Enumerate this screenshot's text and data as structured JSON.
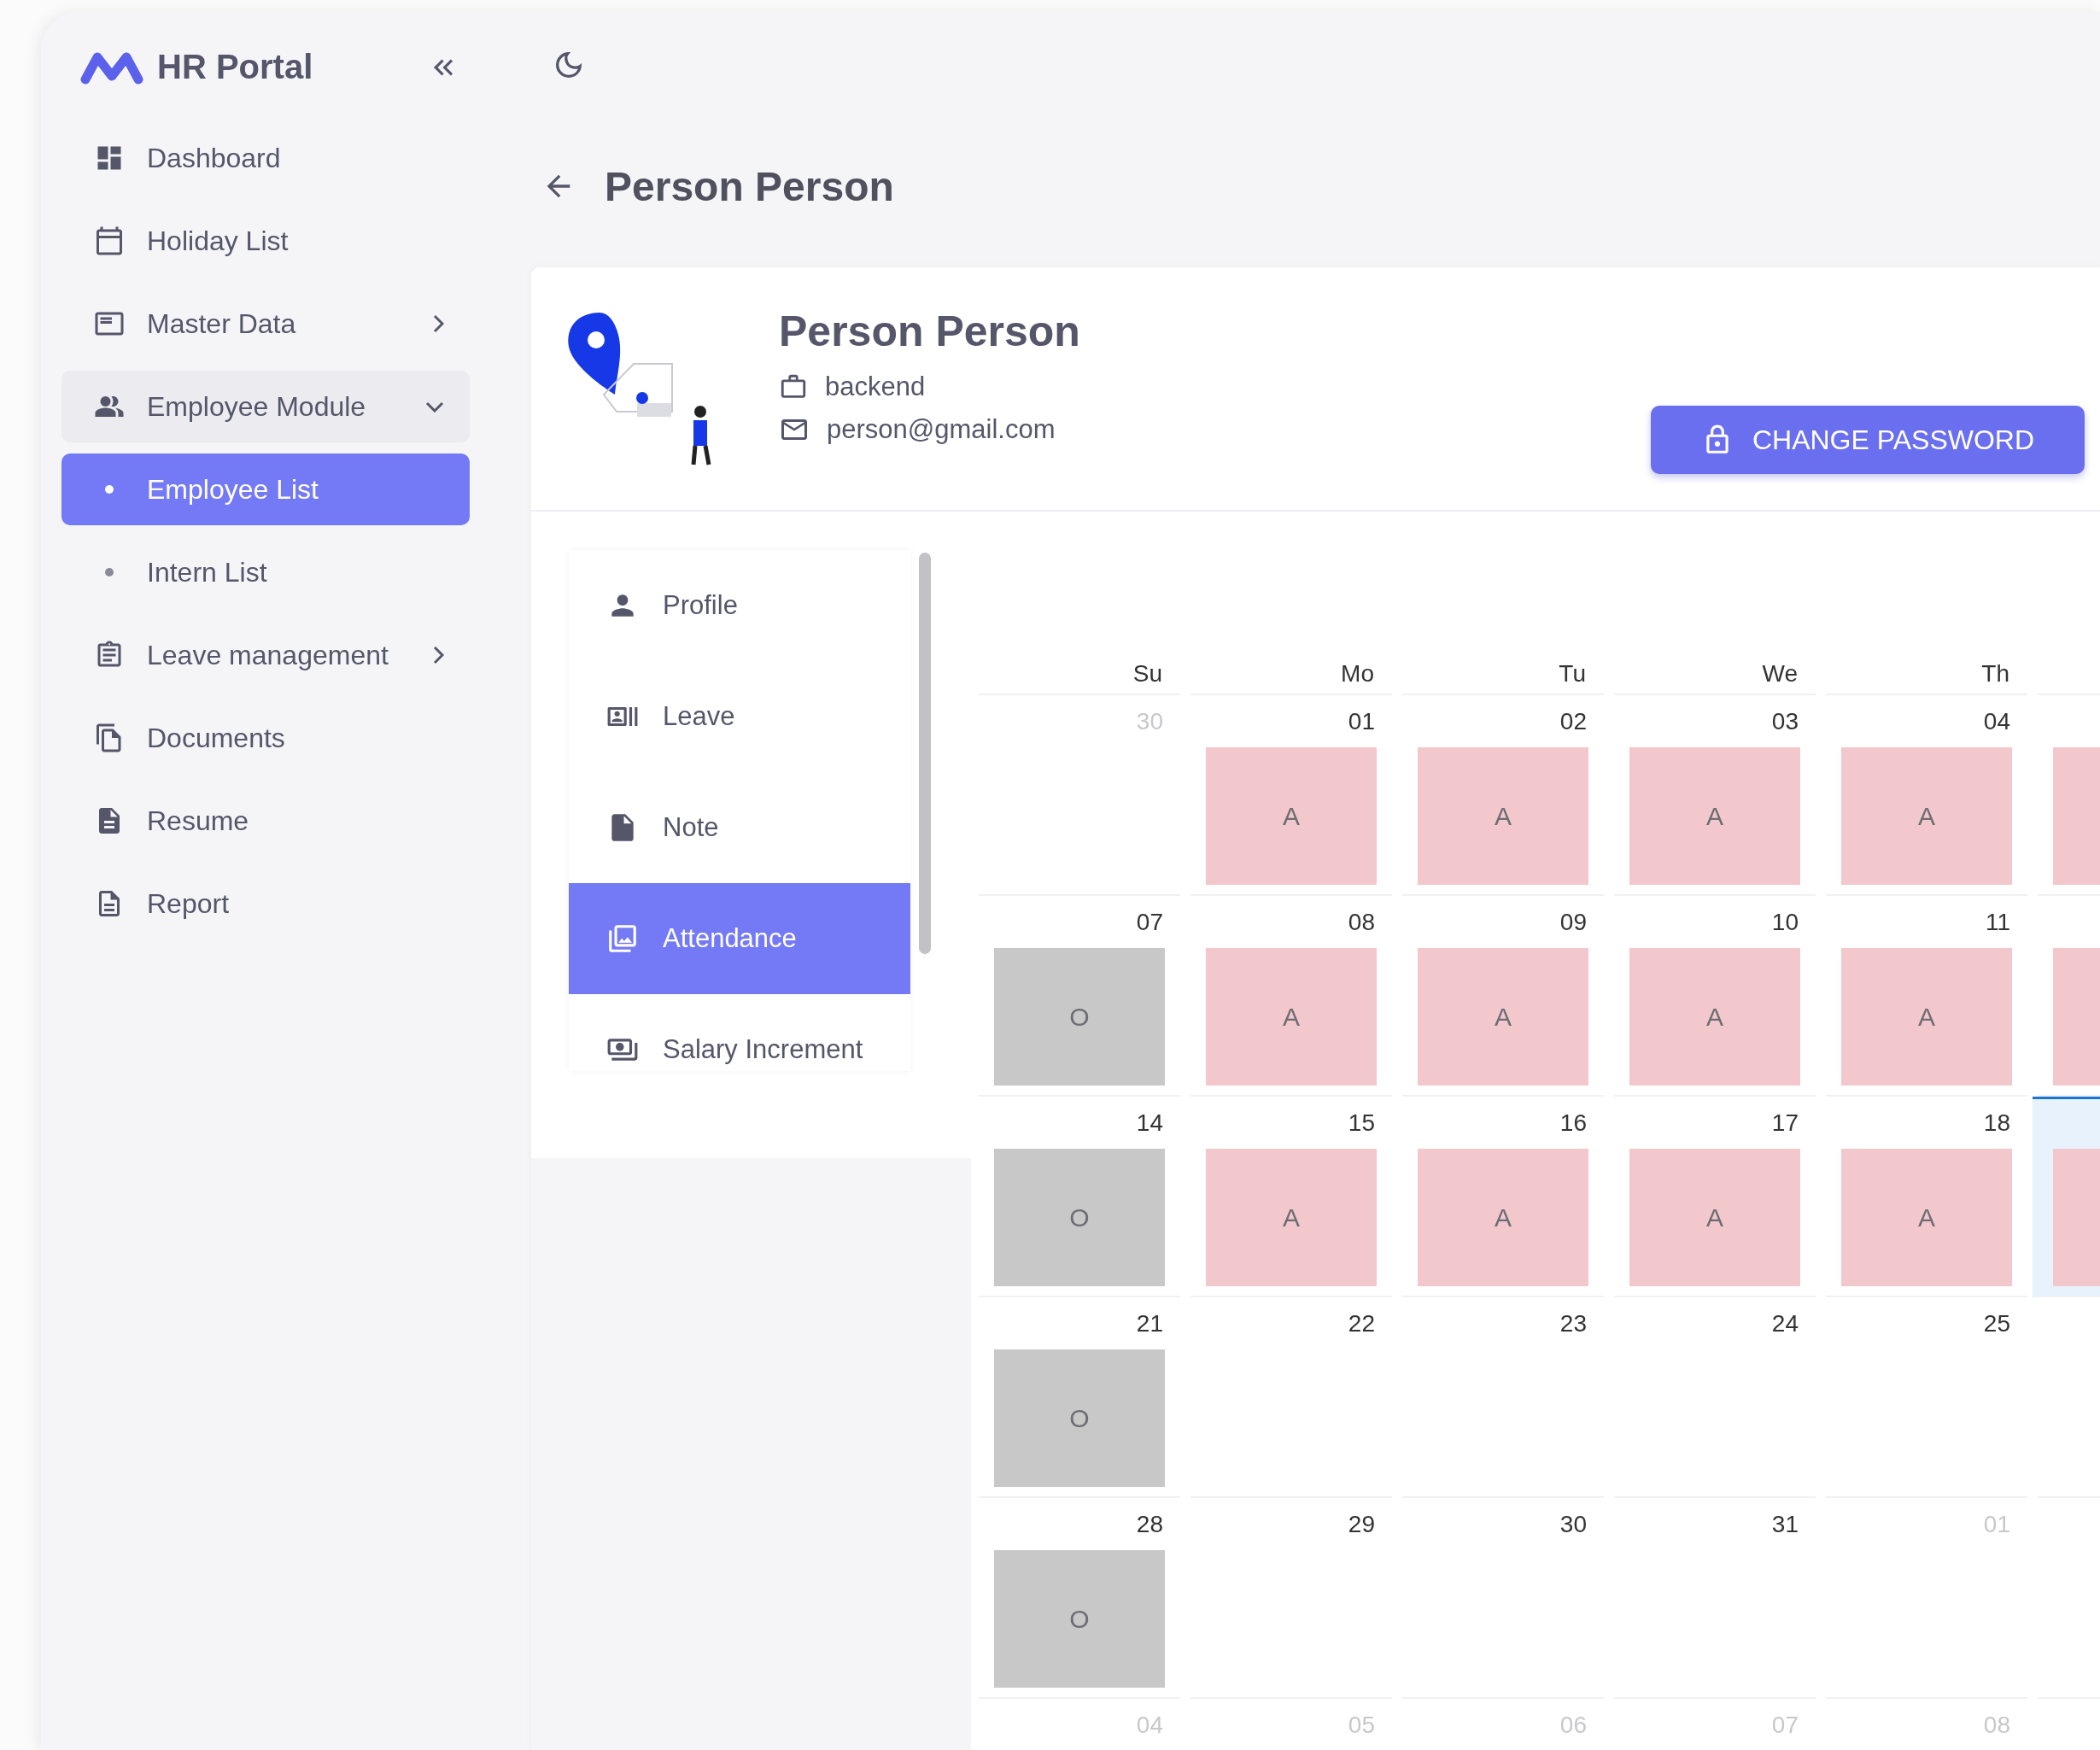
{
  "sidebar": {
    "brand": "HR Portal",
    "items": [
      {
        "kind": "link",
        "label": "Dashboard",
        "selected": false
      },
      {
        "kind": "link",
        "label": "Holiday List",
        "selected": false
      },
      {
        "kind": "group",
        "label": "Master Data",
        "expanded": false
      },
      {
        "kind": "group",
        "label": "Employee Module",
        "expanded": true,
        "children": [
          {
            "kind": "sub",
            "label": "Employee List",
            "selected": true
          },
          {
            "kind": "sub",
            "label": "Intern List",
            "selected": false
          }
        ]
      },
      {
        "kind": "group",
        "label": "Leave management",
        "expanded": false
      },
      {
        "kind": "link",
        "label": "Documents",
        "selected": false
      },
      {
        "kind": "link",
        "label": "Resume",
        "selected": false
      },
      {
        "kind": "link",
        "label": "Report",
        "selected": false
      }
    ]
  },
  "page_title": "Person Person",
  "profile": {
    "name": "Person Person",
    "team": "backend",
    "email": "person@gmail.com",
    "button": "CHANGE PASSWORD"
  },
  "tabs": [
    {
      "label": "Profile",
      "selected": false
    },
    {
      "label": "Leave",
      "selected": false
    },
    {
      "label": "Note",
      "selected": false
    },
    {
      "label": "Attendance",
      "selected": true
    },
    {
      "label": "Salary Increment",
      "selected": false
    }
  ],
  "calendar": {
    "weekdays": [
      "Su",
      "Mo",
      "Tu",
      "We",
      "Th"
    ],
    "weeks": [
      {
        "days": [
          {
            "date": "30",
            "muted": true,
            "kind": "none"
          },
          {
            "date": "01",
            "muted": false,
            "kind": "absent",
            "mark": "A"
          },
          {
            "date": "02",
            "muted": false,
            "kind": "absent",
            "mark": "A"
          },
          {
            "date": "03",
            "muted": false,
            "kind": "absent",
            "mark": "A"
          },
          {
            "date": "04",
            "muted": false,
            "kind": "absent",
            "mark": "A"
          },
          {
            "kind": "absent",
            "today": false
          }
        ]
      },
      {
        "days": [
          {
            "date": "07",
            "muted": false,
            "kind": "off",
            "mark": "O"
          },
          {
            "date": "08",
            "muted": false,
            "kind": "absent",
            "mark": "A"
          },
          {
            "date": "09",
            "muted": false,
            "kind": "absent",
            "mark": "A"
          },
          {
            "date": "10",
            "muted": false,
            "kind": "absent",
            "mark": "A"
          },
          {
            "date": "11",
            "muted": false,
            "kind": "absent",
            "mark": "A"
          },
          {
            "kind": "absent",
            "today": false
          }
        ]
      },
      {
        "days": [
          {
            "date": "14",
            "muted": false,
            "kind": "off",
            "mark": "O"
          },
          {
            "date": "15",
            "muted": false,
            "kind": "absent",
            "mark": "A"
          },
          {
            "date": "16",
            "muted": false,
            "kind": "absent",
            "mark": "A"
          },
          {
            "date": "17",
            "muted": false,
            "kind": "absent",
            "mark": "A"
          },
          {
            "date": "18",
            "muted": false,
            "kind": "absent",
            "mark": "A"
          },
          {
            "kind": "absent",
            "today": true
          }
        ]
      },
      {
        "days": [
          {
            "date": "21",
            "muted": false,
            "kind": "off",
            "mark": "O"
          },
          {
            "date": "22",
            "muted": false,
            "kind": "none"
          },
          {
            "date": "23",
            "muted": false,
            "kind": "none"
          },
          {
            "date": "24",
            "muted": false,
            "kind": "none"
          },
          {
            "date": "25",
            "muted": false,
            "kind": "none"
          },
          {
            "kind": "none"
          }
        ]
      },
      {
        "days": [
          {
            "date": "28",
            "muted": false,
            "kind": "off",
            "mark": "O"
          },
          {
            "date": "29",
            "muted": false,
            "kind": "none"
          },
          {
            "date": "30",
            "muted": false,
            "kind": "none"
          },
          {
            "date": "31",
            "muted": false,
            "kind": "none"
          },
          {
            "date": "01",
            "muted": true,
            "kind": "none"
          },
          {
            "kind": "none"
          }
        ]
      },
      {
        "days": [
          {
            "date": "04",
            "muted": true,
            "kind": "none"
          },
          {
            "date": "05",
            "muted": true,
            "kind": "none"
          },
          {
            "date": "06",
            "muted": true,
            "kind": "none"
          },
          {
            "date": "07",
            "muted": true,
            "kind": "none"
          },
          {
            "date": "08",
            "muted": true,
            "kind": "none"
          },
          {
            "kind": "none"
          }
        ]
      }
    ]
  }
}
